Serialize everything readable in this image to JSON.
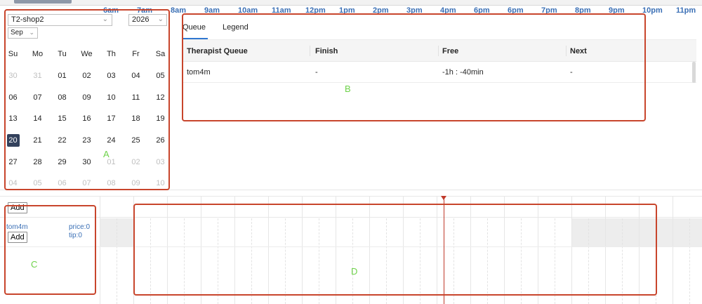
{
  "calendar": {
    "shop": "T2-shop2",
    "year": "2026",
    "month": "Sep",
    "weekdays": [
      "Su",
      "Mo",
      "Tu",
      "We",
      "Th",
      "Fr",
      "Sa"
    ],
    "days": [
      {
        "d": "30",
        "m": true
      },
      {
        "d": "31",
        "m": true
      },
      {
        "d": "01"
      },
      {
        "d": "02"
      },
      {
        "d": "03"
      },
      {
        "d": "04"
      },
      {
        "d": "05"
      },
      {
        "d": "06"
      },
      {
        "d": "07"
      },
      {
        "d": "08"
      },
      {
        "d": "09"
      },
      {
        "d": "10"
      },
      {
        "d": "11"
      },
      {
        "d": "12"
      },
      {
        "d": "13"
      },
      {
        "d": "14"
      },
      {
        "d": "15"
      },
      {
        "d": "16"
      },
      {
        "d": "17"
      },
      {
        "d": "18"
      },
      {
        "d": "19"
      },
      {
        "d": "20",
        "s": true
      },
      {
        "d": "21"
      },
      {
        "d": "22"
      },
      {
        "d": "23"
      },
      {
        "d": "24"
      },
      {
        "d": "25"
      },
      {
        "d": "26"
      },
      {
        "d": "27"
      },
      {
        "d": "28"
      },
      {
        "d": "29"
      },
      {
        "d": "30"
      },
      {
        "d": "01",
        "m": true
      },
      {
        "d": "02",
        "m": true
      },
      {
        "d": "03",
        "m": true
      },
      {
        "d": "04",
        "m": true
      },
      {
        "d": "05",
        "m": true
      },
      {
        "d": "06",
        "m": true
      },
      {
        "d": "07",
        "m": true
      },
      {
        "d": "08",
        "m": true
      },
      {
        "d": "09",
        "m": true
      },
      {
        "d": "10",
        "m": true
      }
    ]
  },
  "tabs": {
    "queue": "Queue",
    "legend": "Legend"
  },
  "queue_table": {
    "headers": {
      "queue": "Therapist Queue",
      "finish": "Finish",
      "free": "Free",
      "next": "Next"
    },
    "rows": [
      {
        "queue": "tom4m",
        "finish": "-",
        "free": "-1h : -40min",
        "next": "-"
      }
    ]
  },
  "timeline": {
    "add_label": "Add",
    "hours": [
      "6am",
      "7am",
      "8am",
      "9am",
      "10am",
      "11am",
      "12pm",
      "1pm",
      "2pm",
      "3pm",
      "4pm",
      "6pm",
      "6pm",
      "7pm",
      "8pm",
      "9pm",
      "10pm",
      "11pm"
    ]
  },
  "technician": {
    "name": "tom4m",
    "price": "price:0",
    "tip": "tip:0",
    "add_label": "Add"
  },
  "annotations": {
    "a": "A",
    "b": "B",
    "c": "C",
    "d": "D"
  }
}
